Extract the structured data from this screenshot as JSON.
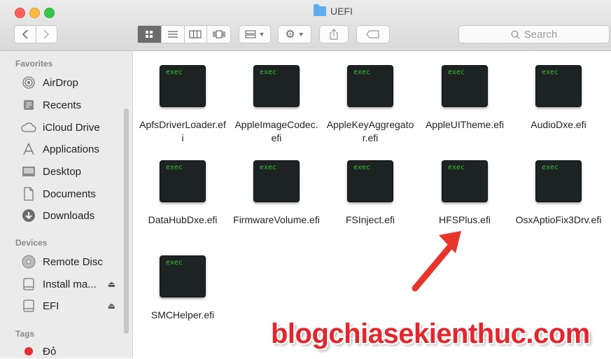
{
  "window": {
    "title": "UEFI"
  },
  "toolbar": {
    "back_icon": "chevron-left-icon",
    "forward_icon": "chevron-right-icon",
    "view_modes": [
      "icon-view",
      "list-view",
      "column-view",
      "coverflow-view"
    ],
    "search_placeholder": "Search"
  },
  "sidebar": {
    "favorites_header": "Favorites",
    "favorites": [
      {
        "label": "AirDrop",
        "icon": "airdrop-icon"
      },
      {
        "label": "Recents",
        "icon": "recents-icon"
      },
      {
        "label": "iCloud Drive",
        "icon": "cloud-icon"
      },
      {
        "label": "Applications",
        "icon": "applications-icon"
      },
      {
        "label": "Desktop",
        "icon": "desktop-icon"
      },
      {
        "label": "Documents",
        "icon": "documents-icon"
      },
      {
        "label": "Downloads",
        "icon": "downloads-icon"
      }
    ],
    "devices_header": "Devices",
    "devices": [
      {
        "label": "Remote Disc",
        "icon": "disc-icon"
      },
      {
        "label": "Install ma...",
        "icon": "drive-icon"
      },
      {
        "label": "EFI",
        "icon": "drive-icon"
      }
    ],
    "tags_header": "Tags",
    "tags": [
      {
        "label": "Đỏ",
        "color": "#e8302f"
      }
    ]
  },
  "files": [
    {
      "name": "ApfsDriverLoader.efi",
      "badge": "exec"
    },
    {
      "name": "AppleImageCodec.efi",
      "badge": "exec"
    },
    {
      "name": "AppleKeyAggregator.efi",
      "badge": "exec"
    },
    {
      "name": "AppleUITheme.efi",
      "badge": "exec"
    },
    {
      "name": "AudioDxe.efi",
      "badge": "exec"
    },
    {
      "name": "DataHubDxe.efi",
      "badge": "exec"
    },
    {
      "name": "FirmwareVolume.efi",
      "badge": "exec"
    },
    {
      "name": "FSInject.efi",
      "badge": "exec"
    },
    {
      "name": "HFSPlus.efi",
      "badge": "exec"
    },
    {
      "name": "OsxAptioFix3Drv.efi",
      "badge": "exec"
    },
    {
      "name": "SMCHelper.efi",
      "badge": "exec"
    }
  ],
  "watermark": "blogchiasekienthuc.com",
  "colors": {
    "accent_arrow": "#e8352b",
    "watermark": "#e4252d",
    "exec_text": "#35c135"
  }
}
